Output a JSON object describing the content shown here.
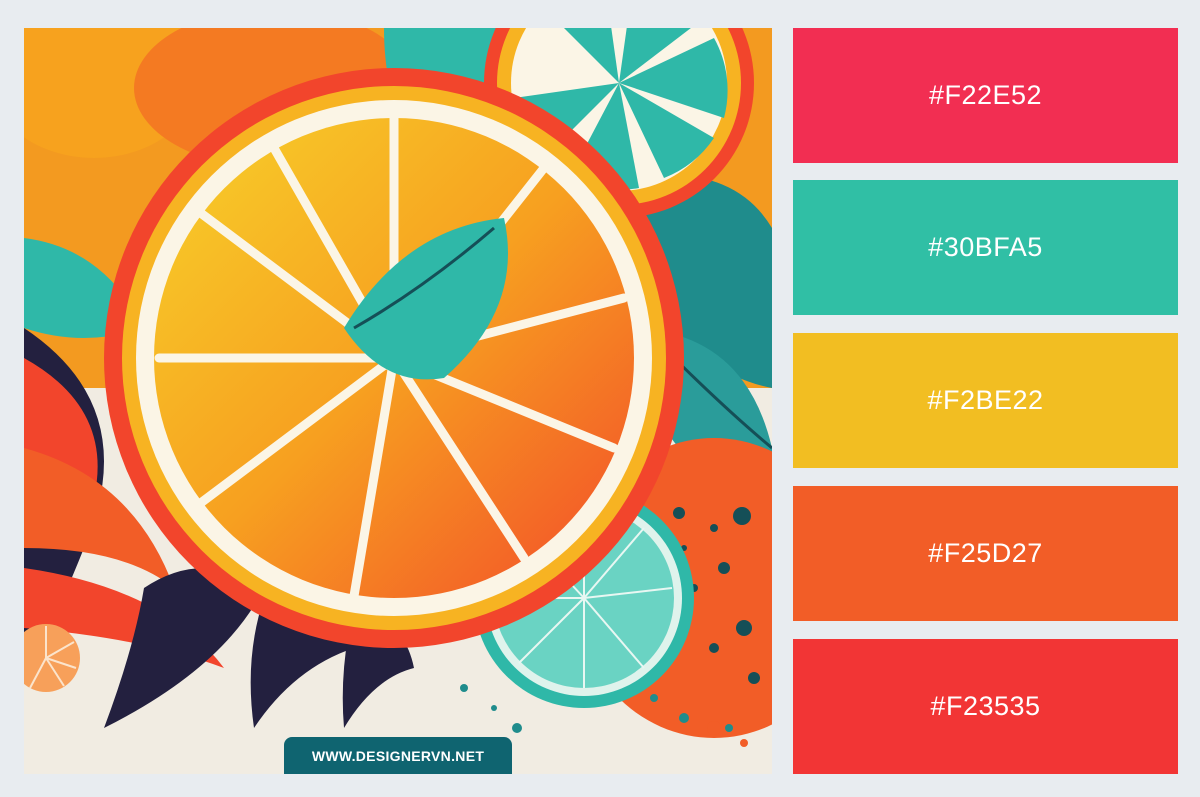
{
  "watermark": {
    "text": "WWW.DESIGNERVN.NET"
  },
  "palette": [
    {
      "hex": "#F22E52",
      "color": "#F22E52"
    },
    {
      "hex": "#30BFA5",
      "color": "#30BFA5"
    },
    {
      "hex": "#F2BE22",
      "color": "#F2BE22"
    },
    {
      "hex": "#F25D27",
      "color": "#F25D27"
    },
    {
      "hex": "#F23535",
      "color": "#F23535"
    }
  ],
  "artwork": {
    "subject": "citrus-slices-illustration",
    "colors": {
      "background": "#f1ece2",
      "teal": "#2fb8a8",
      "deep-teal": "#1f8c8c",
      "yellow": "#f6c928",
      "orange": "#f47a22",
      "red-orange": "#f2452c",
      "navy": "#23203f",
      "cream": "#fbf5e6"
    }
  }
}
